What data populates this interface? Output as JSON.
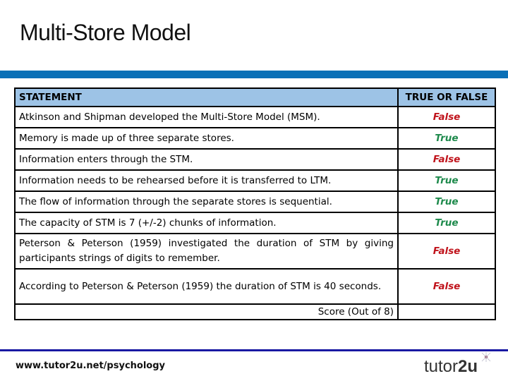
{
  "slide": {
    "title": "Multi-Store Model"
  },
  "table": {
    "headers": {
      "statement": "STATEMENT",
      "answer": "TRUE OR FALSE"
    },
    "rows": [
      {
        "statement": "Atkinson and Shipman developed the Multi-Store Model (MSM).",
        "answer": "False"
      },
      {
        "statement": "Memory is made up of three separate stores.",
        "answer": "True"
      },
      {
        "statement": "Information enters through the STM.",
        "answer": "False"
      },
      {
        "statement": "Information needs to be rehearsed before it is transferred to LTM.",
        "answer": "True"
      },
      {
        "statement": "The flow of information through the separate stores is sequential.",
        "answer": "True"
      },
      {
        "statement": "The capacity of STM is 7 (+/-2) chunks of information.",
        "answer": "True"
      },
      {
        "statement": "Peterson & Peterson (1959) investigated the duration of STM by giving participants strings of digits to remember.",
        "answer": "False"
      },
      {
        "statement": "According to Peterson & Peterson (1959) the duration of STM is 40 seconds.",
        "answer": "False"
      }
    ],
    "score_label": "Score (Out of 8)",
    "score_value": ""
  },
  "colors": {
    "true": "#1e8a4c",
    "false": "#c0141c",
    "header_bg": "#9dc3e6",
    "top_bar": "#0a70b7",
    "bottom_line": "#1919a3"
  },
  "footer": {
    "url": "www.tutor2u.net/psychology",
    "logo_light": "tutor",
    "logo_bold": "2u"
  }
}
